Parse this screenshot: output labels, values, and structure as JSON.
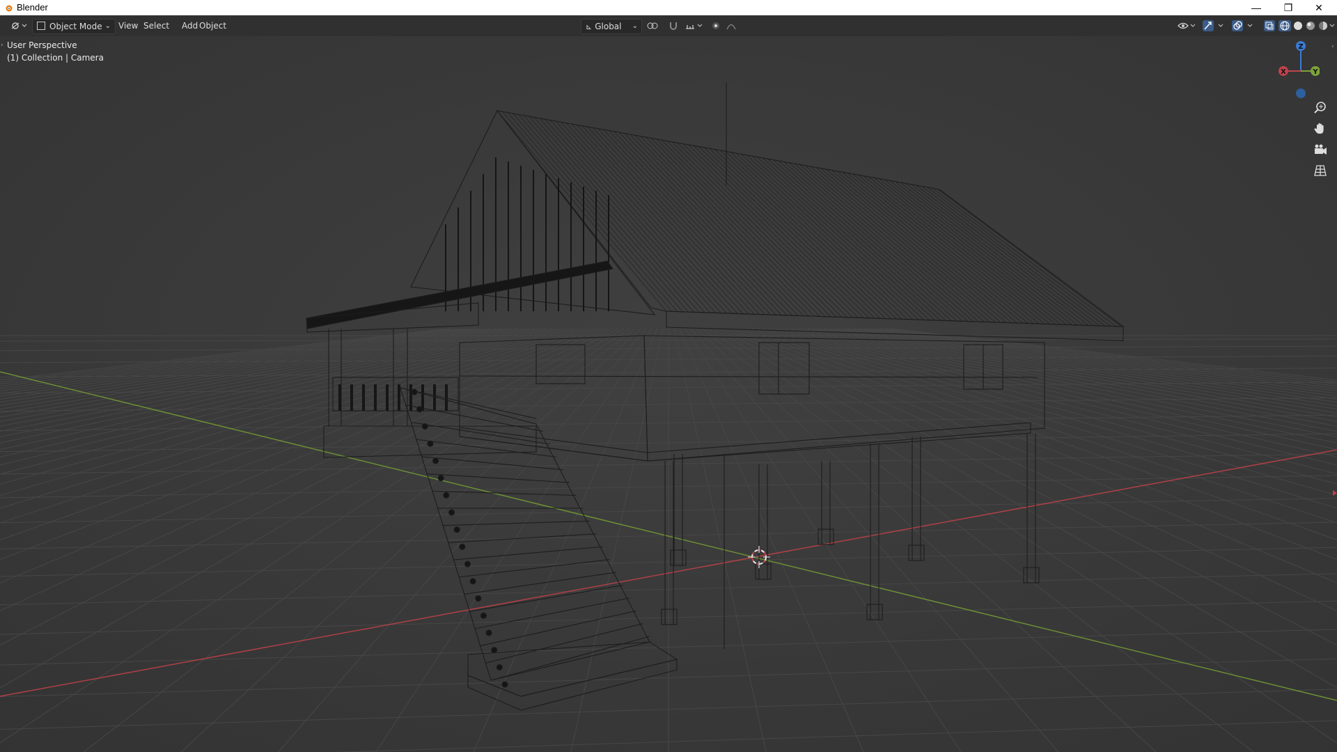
{
  "window": {
    "title": "Blender",
    "minimize": "—",
    "maximize": "❐",
    "close": "✕"
  },
  "header": {
    "mode_label": "Object Mode",
    "menus": [
      "View",
      "Select",
      "Add",
      "Object"
    ],
    "transform_orientation": "Global"
  },
  "viewport": {
    "view_name": "User Perspective",
    "collection_info": "(1) Collection | Camera",
    "gizmo": {
      "z": "Z",
      "y": "Y",
      "x": "X"
    }
  },
  "colors": {
    "x_axis": "#c0434c",
    "y_axis": "#7da33a",
    "z_axis": "#3a7cd6",
    "grid": "#444444",
    "background": "#3a3a3a",
    "wire": "#1c1c1c"
  }
}
